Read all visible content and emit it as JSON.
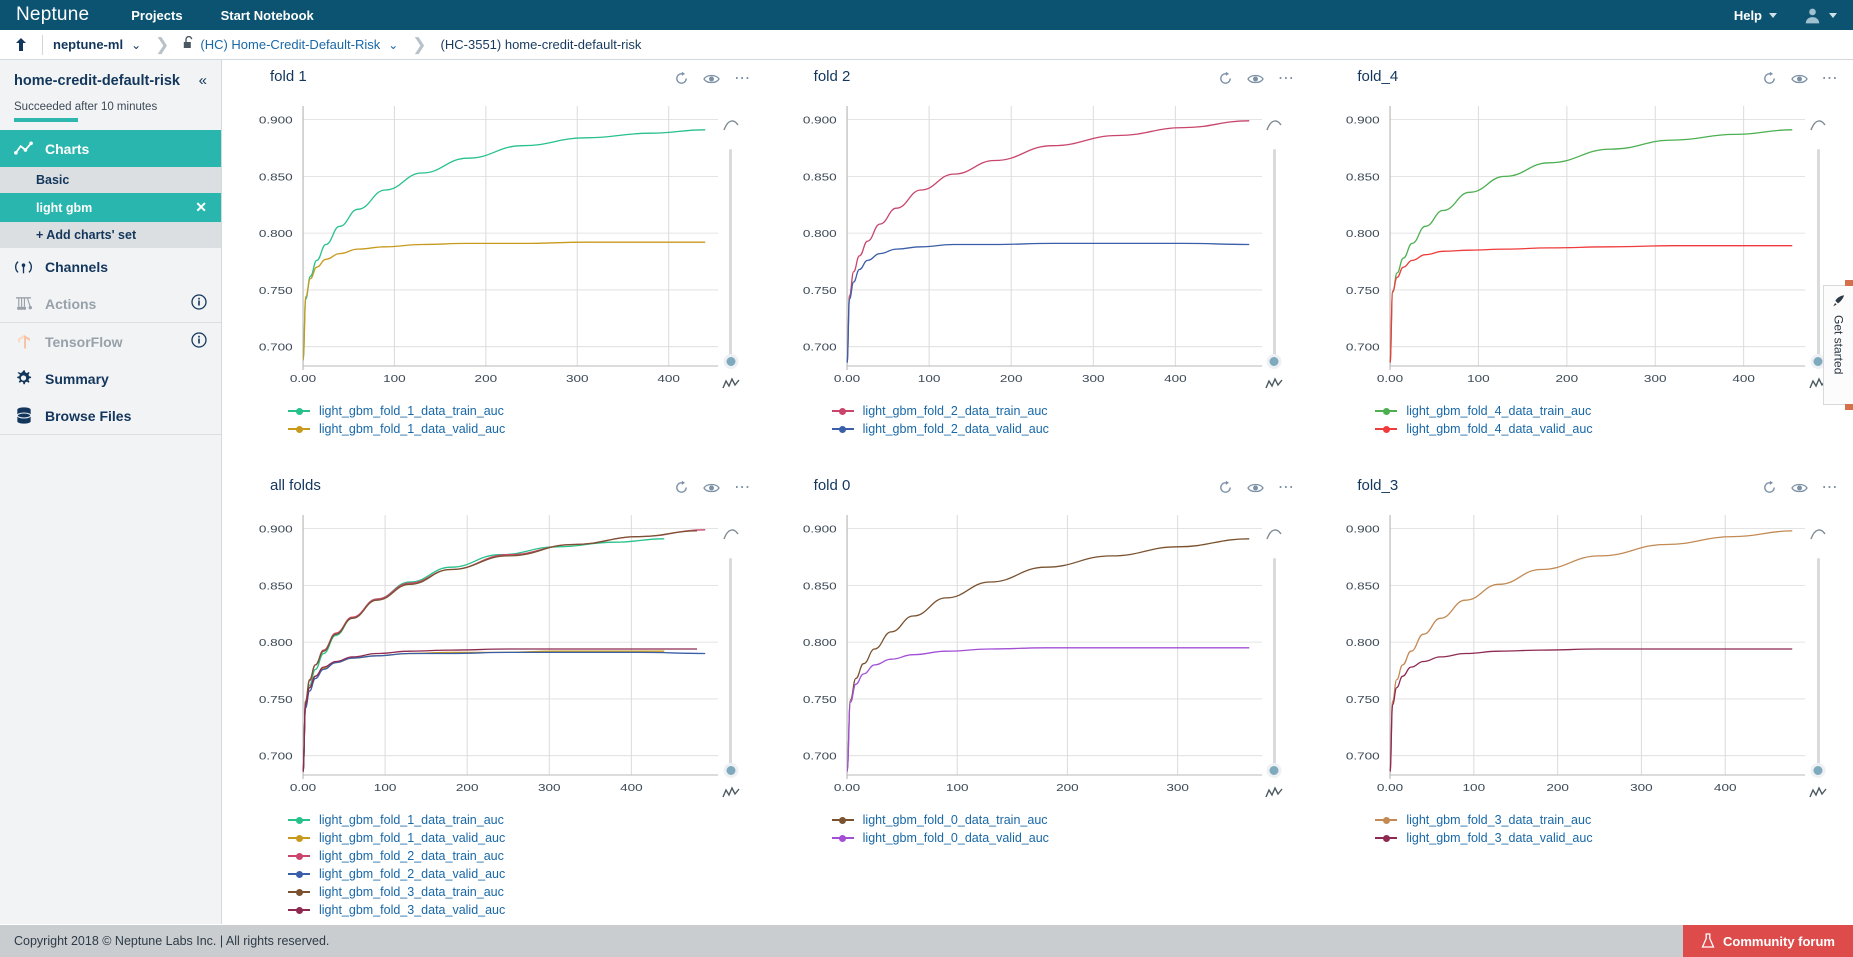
{
  "topnav": {
    "brand": "Neptune",
    "links": [
      "Projects",
      "Start Notebook"
    ],
    "help": "Help"
  },
  "breadcrumb": {
    "workspace": "neptune-ml",
    "project": "(HC) Home-Credit-Default-Risk",
    "experiment": "(HC-3551) home-credit-default-risk"
  },
  "sidebar": {
    "title": "home-credit-default-risk",
    "status": "Succeeded after 10 minutes",
    "items": [
      {
        "label": "Charts",
        "icon": "line-chart-icon",
        "state": "active"
      },
      {
        "label": "Channels",
        "icon": "broadcast-icon",
        "state": "normal"
      },
      {
        "label": "Actions",
        "icon": "newton-cradle-icon",
        "state": "disabled",
        "info": true
      },
      {
        "label": "TensorFlow",
        "icon": "tensorflow-icon",
        "state": "disabled",
        "info": true
      },
      {
        "label": "Summary",
        "icon": "gear-icon",
        "state": "normal"
      },
      {
        "label": "Browse Files",
        "icon": "database-icon",
        "state": "normal"
      }
    ],
    "chart_sets": [
      {
        "label": "Basic",
        "selected": false
      },
      {
        "label": "light gbm",
        "selected": true
      },
      {
        "label": "+ Add charts' set",
        "selected": false
      }
    ]
  },
  "footer": {
    "copyright": "Copyright 2018 © Neptune Labs Inc. | All rights reserved.",
    "forum_label": "Community forum"
  },
  "get_started": {
    "label": "Get started"
  },
  "chart_tools": {
    "reset": "reset-icon",
    "visibility": "eye-icon",
    "more": "more-icon"
  },
  "chart_data": [
    {
      "type": "line",
      "title": "fold 1",
      "xlabel": "",
      "ylabel": "",
      "xlim": [
        0,
        440
      ],
      "ylim": [
        0.683,
        0.912
      ],
      "yticks": [
        0.7,
        0.75,
        0.8,
        0.85,
        0.9
      ],
      "ytick_labels": [
        "0.700",
        "0.750",
        "0.800",
        "0.850",
        "0.900"
      ],
      "xticks": [
        0,
        100,
        200,
        300,
        400
      ],
      "xtick_labels": [
        "0.00",
        "100",
        "200",
        "300",
        "400"
      ],
      "grid": true,
      "legend_position": "bottom-left",
      "series": [
        {
          "name": "light_gbm_fold_1_data_train_auc",
          "color": "#27c18a",
          "x": [
            0,
            3,
            8,
            15,
            25,
            40,
            60,
            90,
            130,
            180,
            240,
            310,
            380,
            440
          ],
          "y": [
            0.688,
            0.742,
            0.762,
            0.776,
            0.79,
            0.806,
            0.821,
            0.838,
            0.853,
            0.866,
            0.877,
            0.884,
            0.888,
            0.891
          ]
        },
        {
          "name": "light_gbm_fold_1_data_valid_auc",
          "color": "#c79a1e",
          "x": [
            0,
            3,
            8,
            15,
            25,
            40,
            60,
            90,
            130,
            180,
            240,
            310,
            380,
            440
          ],
          "y": [
            0.688,
            0.744,
            0.76,
            0.77,
            0.777,
            0.782,
            0.786,
            0.788,
            0.79,
            0.791,
            0.791,
            0.792,
            0.792,
            0.792
          ]
        }
      ]
    },
    {
      "type": "line",
      "title": "fold 2",
      "xlabel": "",
      "ylabel": "",
      "xlim": [
        0,
        490
      ],
      "ylim": [
        0.683,
        0.912
      ],
      "yticks": [
        0.7,
        0.75,
        0.8,
        0.85,
        0.9
      ],
      "ytick_labels": [
        "0.700",
        "0.750",
        "0.800",
        "0.850",
        "0.900"
      ],
      "xticks": [
        0,
        100,
        200,
        300,
        400
      ],
      "xtick_labels": [
        "0.00",
        "100",
        "200",
        "300",
        "400"
      ],
      "grid": true,
      "legend_position": "bottom-left",
      "series": [
        {
          "name": "light_gbm_fold_2_data_train_auc",
          "color": "#c9456c",
          "x": [
            0,
            3,
            8,
            15,
            25,
            40,
            60,
            90,
            130,
            180,
            250,
            330,
            410,
            490
          ],
          "y": [
            0.686,
            0.745,
            0.766,
            0.78,
            0.793,
            0.808,
            0.822,
            0.838,
            0.852,
            0.864,
            0.877,
            0.886,
            0.893,
            0.899
          ]
        },
        {
          "name": "light_gbm_fold_2_data_valid_auc",
          "color": "#3b5ea8",
          "x": [
            0,
            3,
            8,
            15,
            25,
            40,
            60,
            90,
            130,
            180,
            250,
            330,
            410,
            490
          ],
          "y": [
            0.686,
            0.742,
            0.757,
            0.768,
            0.776,
            0.782,
            0.786,
            0.788,
            0.79,
            0.79,
            0.791,
            0.791,
            0.791,
            0.79
          ]
        }
      ]
    },
    {
      "type": "line",
      "title": "fold_4",
      "xlabel": "",
      "ylabel": "",
      "xlim": [
        0,
        455
      ],
      "ylim": [
        0.683,
        0.912
      ],
      "yticks": [
        0.7,
        0.75,
        0.8,
        0.85,
        0.9
      ],
      "ytick_labels": [
        "0.700",
        "0.750",
        "0.800",
        "0.850",
        "0.900"
      ],
      "xticks": [
        0,
        100,
        200,
        300,
        400
      ],
      "xtick_labels": [
        "0.00",
        "100",
        "200",
        "300",
        "400"
      ],
      "grid": true,
      "legend_position": "bottom-left",
      "series": [
        {
          "name": "light_gbm_fold_4_data_train_auc",
          "color": "#4caf50",
          "x": [
            0,
            3,
            8,
            15,
            25,
            40,
            60,
            90,
            130,
            180,
            250,
            320,
            390,
            455
          ],
          "y": [
            0.686,
            0.748,
            0.765,
            0.778,
            0.791,
            0.806,
            0.82,
            0.836,
            0.85,
            0.862,
            0.874,
            0.882,
            0.887,
            0.891
          ]
        },
        {
          "name": "light_gbm_fold_4_data_valid_auc",
          "color": "#ef3b3b",
          "x": [
            0,
            3,
            8,
            15,
            25,
            40,
            60,
            90,
            130,
            180,
            250,
            320,
            390,
            455
          ],
          "y": [
            0.686,
            0.749,
            0.761,
            0.77,
            0.776,
            0.781,
            0.784,
            0.785,
            0.786,
            0.787,
            0.788,
            0.789,
            0.789,
            0.789
          ]
        }
      ]
    },
    {
      "type": "line",
      "title": "all folds",
      "xlabel": "",
      "ylabel": "",
      "xlim": [
        0,
        490
      ],
      "ylim": [
        0.683,
        0.912
      ],
      "yticks": [
        0.7,
        0.75,
        0.8,
        0.85,
        0.9
      ],
      "ytick_labels": [
        "0.700",
        "0.750",
        "0.800",
        "0.850",
        "0.900"
      ],
      "xticks": [
        0,
        100,
        200,
        300,
        400
      ],
      "xtick_labels": [
        "0.00",
        "100",
        "200",
        "300",
        "400"
      ],
      "grid": true,
      "legend_position": "bottom-left",
      "series": [
        {
          "name": "light_gbm_fold_1_data_train_auc",
          "color": "#27c18a",
          "x": [
            0,
            3,
            8,
            15,
            25,
            40,
            60,
            90,
            130,
            180,
            240,
            310,
            380,
            440
          ],
          "y": [
            0.688,
            0.742,
            0.762,
            0.776,
            0.79,
            0.806,
            0.821,
            0.838,
            0.853,
            0.866,
            0.877,
            0.884,
            0.888,
            0.891
          ]
        },
        {
          "name": "light_gbm_fold_1_data_valid_auc",
          "color": "#c79a1e",
          "x": [
            0,
            3,
            8,
            15,
            25,
            40,
            60,
            90,
            130,
            180,
            240,
            310,
            380,
            440
          ],
          "y": [
            0.688,
            0.744,
            0.76,
            0.77,
            0.777,
            0.782,
            0.786,
            0.788,
            0.79,
            0.791,
            0.791,
            0.792,
            0.792,
            0.792
          ]
        },
        {
          "name": "light_gbm_fold_2_data_train_auc",
          "color": "#c9456c",
          "x": [
            0,
            3,
            8,
            15,
            25,
            40,
            60,
            90,
            130,
            180,
            250,
            330,
            410,
            490
          ],
          "y": [
            0.686,
            0.745,
            0.766,
            0.78,
            0.793,
            0.808,
            0.822,
            0.838,
            0.852,
            0.864,
            0.877,
            0.886,
            0.893,
            0.899
          ]
        },
        {
          "name": "light_gbm_fold_2_data_valid_auc",
          "color": "#3b5ea8",
          "x": [
            0,
            3,
            8,
            15,
            25,
            40,
            60,
            90,
            130,
            180,
            250,
            330,
            410,
            490
          ],
          "y": [
            0.686,
            0.742,
            0.757,
            0.768,
            0.776,
            0.782,
            0.786,
            0.788,
            0.79,
            0.79,
            0.791,
            0.791,
            0.791,
            0.79
          ]
        },
        {
          "name": "light_gbm_fold_3_data_train_auc",
          "color": "#7a5230",
          "x": [
            0,
            3,
            8,
            15,
            25,
            40,
            60,
            90,
            130,
            180,
            250,
            330,
            410,
            480
          ],
          "y": [
            0.686,
            0.748,
            0.767,
            0.78,
            0.792,
            0.807,
            0.821,
            0.837,
            0.851,
            0.864,
            0.876,
            0.886,
            0.893,
            0.898
          ]
        },
        {
          "name": "light_gbm_fold_3_data_valid_auc",
          "color": "#8e2a52",
          "x": [
            0,
            3,
            8,
            15,
            25,
            40,
            60,
            90,
            130,
            180,
            250,
            330,
            410,
            480
          ],
          "y": [
            0.686,
            0.745,
            0.76,
            0.77,
            0.778,
            0.783,
            0.787,
            0.79,
            0.792,
            0.793,
            0.794,
            0.794,
            0.794,
            0.794
          ]
        }
      ]
    },
    {
      "type": "line",
      "title": "fold 0",
      "xlabel": "",
      "ylabel": "",
      "xlim": [
        0,
        365
      ],
      "ylim": [
        0.683,
        0.912
      ],
      "yticks": [
        0.7,
        0.75,
        0.8,
        0.85,
        0.9
      ],
      "ytick_labels": [
        "0.700",
        "0.750",
        "0.800",
        "0.850",
        "0.900"
      ],
      "xticks": [
        0,
        100,
        200,
        300
      ],
      "xtick_labels": [
        "0.00",
        "100",
        "200",
        "300"
      ],
      "grid": true,
      "legend_position": "bottom-left",
      "series": [
        {
          "name": "light_gbm_fold_0_data_train_auc",
          "color": "#7a5230",
          "x": [
            0,
            3,
            8,
            15,
            25,
            40,
            60,
            90,
            130,
            180,
            240,
            300,
            365
          ],
          "y": [
            0.686,
            0.749,
            0.768,
            0.781,
            0.794,
            0.809,
            0.823,
            0.839,
            0.853,
            0.866,
            0.876,
            0.884,
            0.891
          ]
        },
        {
          "name": "light_gbm_fold_0_data_valid_auc",
          "color": "#a24fd6",
          "x": [
            0,
            3,
            8,
            15,
            25,
            40,
            60,
            90,
            130,
            180,
            240,
            300,
            365
          ],
          "y": [
            0.686,
            0.747,
            0.763,
            0.772,
            0.78,
            0.785,
            0.789,
            0.792,
            0.794,
            0.795,
            0.795,
            0.795,
            0.795
          ]
        }
      ]
    },
    {
      "type": "line",
      "title": "fold_3",
      "xlabel": "",
      "ylabel": "",
      "xlim": [
        0,
        480
      ],
      "ylim": [
        0.683,
        0.912
      ],
      "yticks": [
        0.7,
        0.75,
        0.8,
        0.85,
        0.9
      ],
      "ytick_labels": [
        "0.700",
        "0.750",
        "0.800",
        "0.850",
        "0.900"
      ],
      "xticks": [
        0,
        100,
        200,
        300,
        400
      ],
      "xtick_labels": [
        "0.00",
        "100",
        "200",
        "300",
        "400"
      ],
      "grid": true,
      "legend_position": "bottom-left",
      "series": [
        {
          "name": "light_gbm_fold_3_data_train_auc",
          "color": "#c38a54",
          "x": [
            0,
            3,
            8,
            15,
            25,
            40,
            60,
            90,
            130,
            180,
            250,
            330,
            410,
            480
          ],
          "y": [
            0.686,
            0.748,
            0.767,
            0.78,
            0.792,
            0.807,
            0.821,
            0.837,
            0.851,
            0.864,
            0.876,
            0.886,
            0.893,
            0.898
          ]
        },
        {
          "name": "light_gbm_fold_3_data_valid_auc",
          "color": "#8e2a52",
          "x": [
            0,
            3,
            8,
            15,
            25,
            40,
            60,
            90,
            130,
            180,
            250,
            330,
            410,
            480
          ],
          "y": [
            0.686,
            0.745,
            0.76,
            0.77,
            0.778,
            0.783,
            0.787,
            0.79,
            0.792,
            0.793,
            0.794,
            0.794,
            0.794,
            0.794
          ]
        }
      ]
    }
  ]
}
